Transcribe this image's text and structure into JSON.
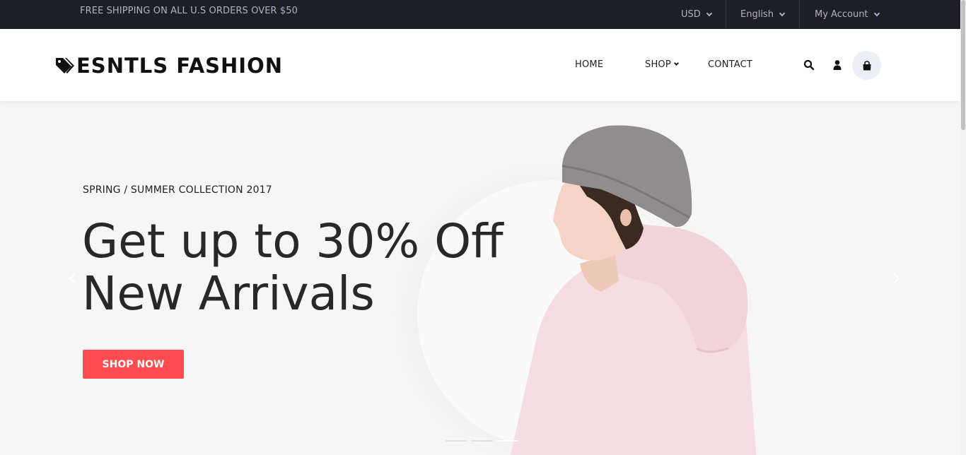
{
  "topbar": {
    "promo": "FREE SHIPPING ON ALL U.S ORDERS OVER $50",
    "currency": "USD",
    "language": "English",
    "account": "My Account"
  },
  "header": {
    "logo_text": "ESNTLS FASHION",
    "nav": {
      "home": "HOME",
      "shop": "SHOP",
      "contact": "CONTACT"
    },
    "icons": [
      "search-icon",
      "user-icon",
      "shopping-bag-icon"
    ]
  },
  "hero": {
    "subtitle": "SPRING / SUMMER COLLECTION 2017",
    "headline_line1": "Get up to 30% Off",
    "headline_line2": "New Arrivals",
    "cta_label": "SHOP NOW",
    "slides_count": 3,
    "active_slide": 3
  },
  "colors": {
    "topbar_bg": "#1e1e27",
    "accent": "#fe4c50",
    "hero_bg": "#f6f6f6"
  }
}
